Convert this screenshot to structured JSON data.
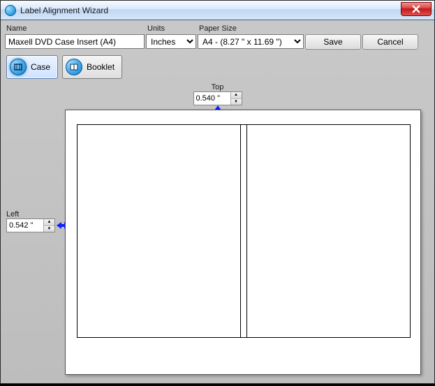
{
  "window": {
    "title": "Label Alignment Wizard"
  },
  "toolbar": {
    "name_label": "Name",
    "name_value": "Maxell DVD Case Insert (A4)",
    "units_label": "Units",
    "units_value": "Inches",
    "paper_label": "Paper Size",
    "paper_value": "A4 - (8.27 \" x 11.69 \")",
    "save_label": "Save",
    "cancel_label": "Cancel"
  },
  "tabs": {
    "case_label": "Case",
    "booklet_label": "Booklet"
  },
  "margins": {
    "top_label": "Top",
    "top_value": "0.540 \"",
    "left_label": "Left",
    "left_value": "0.542 \""
  }
}
